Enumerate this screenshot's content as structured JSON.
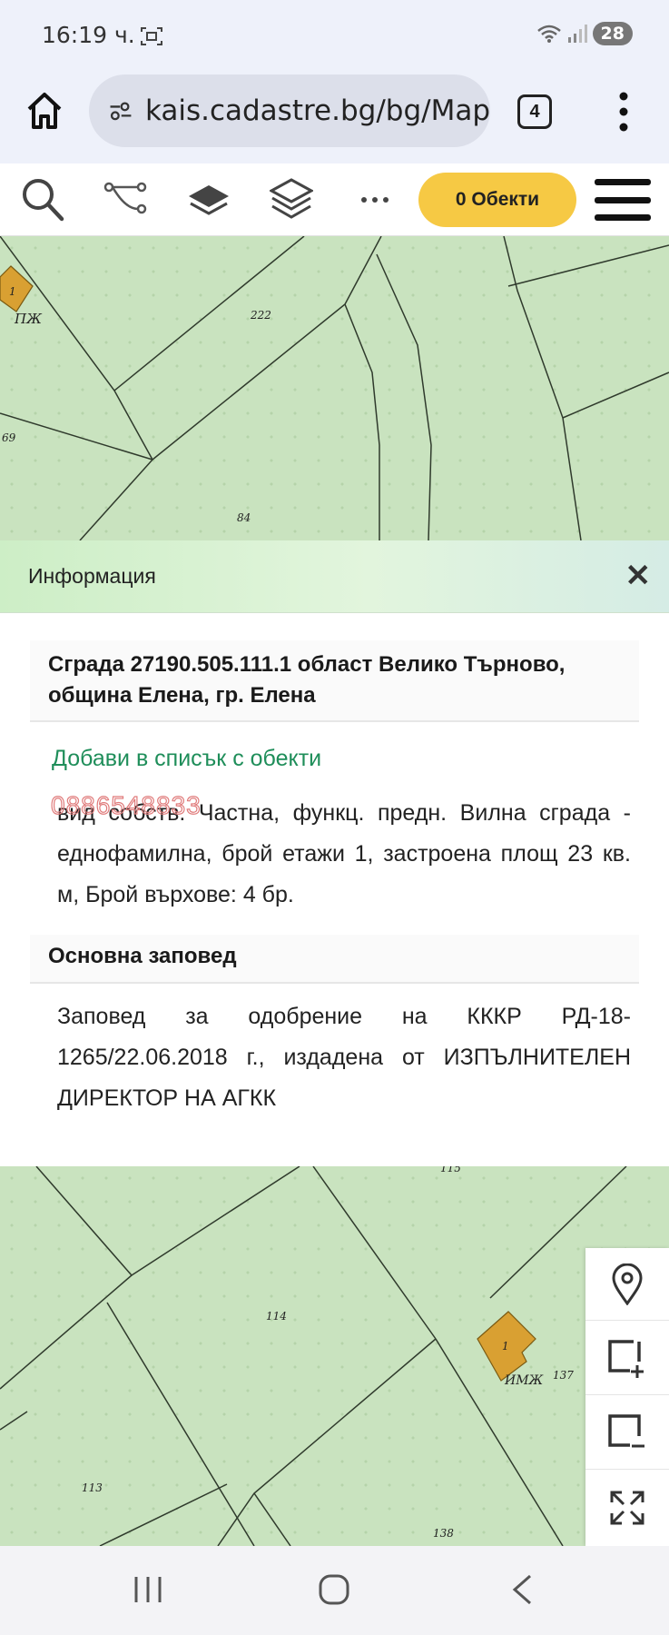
{
  "status_bar": {
    "time": "16:19 ч.",
    "battery": "28"
  },
  "browser": {
    "url": "kais.cadastre.bg/bg/Map",
    "tab_count": "4"
  },
  "toolbar": {
    "objects_button": "0 Обекти"
  },
  "map_top": {
    "labels": {
      "p222": "222",
      "p69": "69",
      "p84": "84",
      "pzh": "ПЖ",
      "one": "1"
    }
  },
  "map_bottom": {
    "labels": {
      "p115": "115",
      "p114": "114",
      "p113": "113",
      "p137": "137",
      "p138": "138",
      "imzh": "ИМЖ",
      "one": "1"
    }
  },
  "info_panel": {
    "header": "Информация",
    "building_title": "Сграда 27190.505.111.1 област Велико Търново, община Елена, гр. Елена",
    "add_link": "Добави в списък с обекти",
    "watermark_phone": "0886548833",
    "description": "вид собств. Частна, функц. предн. Вилна сграда - еднофамилна, брой етажи 1, застроена площ 23 кв. м, Брой върхове: 4 бр.",
    "order_heading": "Основна заповед",
    "order_text": "Заповед за одобрение на КККР РД-18-1265/22.06.2018 г., издадена от ИЗПЪЛНИТЕЛЕН ДИРЕКТОР НА АГКК"
  },
  "colors": {
    "map_fill": "#c9e3bf",
    "parcel_line": "#2f3a2c",
    "building": "#d9a032",
    "link": "#1f8e5a",
    "objects_btn": "#f6c944"
  },
  "icons": [
    "search-icon",
    "route-icon",
    "layer-icon",
    "layers-stack-icon",
    "more-icon",
    "location-pin-icon",
    "add-area-icon",
    "remove-area-icon",
    "fullscreen-icon"
  ]
}
